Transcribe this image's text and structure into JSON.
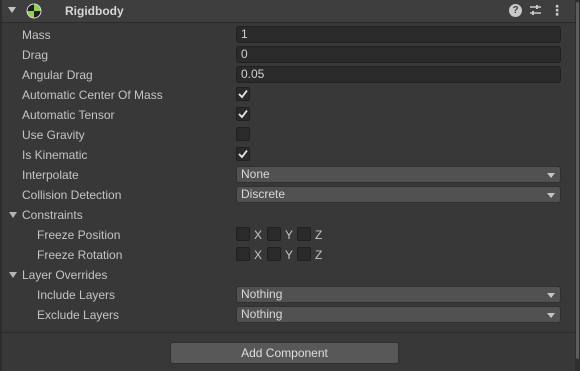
{
  "header": {
    "title": "Rigidbody",
    "icons": [
      "foldout-arrow",
      "rigidbody-icon",
      "help-icon",
      "presets-icon",
      "menu-icon"
    ],
    "help_glyph": "?",
    "menu_glyph": "⋮"
  },
  "fields": {
    "mass": {
      "label": "Mass",
      "value": "1"
    },
    "drag": {
      "label": "Drag",
      "value": "0"
    },
    "angular_drag": {
      "label": "Angular Drag",
      "value": "0.05"
    },
    "auto_center_of_mass": {
      "label": "Automatic Center Of Mass",
      "checked": true
    },
    "auto_tensor": {
      "label": "Automatic Tensor",
      "checked": true
    },
    "use_gravity": {
      "label": "Use Gravity",
      "checked": false
    },
    "is_kinematic": {
      "label": "Is Kinematic",
      "checked": true
    },
    "interpolate": {
      "label": "Interpolate",
      "value": "None"
    },
    "collision_detection": {
      "label": "Collision Detection",
      "value": "Discrete"
    }
  },
  "constraints": {
    "label": "Constraints",
    "freeze_position": {
      "label": "Freeze Position",
      "x": "X",
      "y": "Y",
      "z": "Z"
    },
    "freeze_rotation": {
      "label": "Freeze Rotation",
      "x": "X",
      "y": "Y",
      "z": "Z"
    }
  },
  "layer_overrides": {
    "label": "Layer Overrides",
    "include_layers": {
      "label": "Include Layers",
      "value": "Nothing"
    },
    "exclude_layers": {
      "label": "Exclude Layers",
      "value": "Nothing"
    }
  },
  "add_component": {
    "label": "Add Component"
  },
  "colors": {
    "background": "#383838",
    "header": "#3e3e3e",
    "field": "#2a2a2a",
    "dropdown": "#515151",
    "text": "#c4c4c4"
  }
}
